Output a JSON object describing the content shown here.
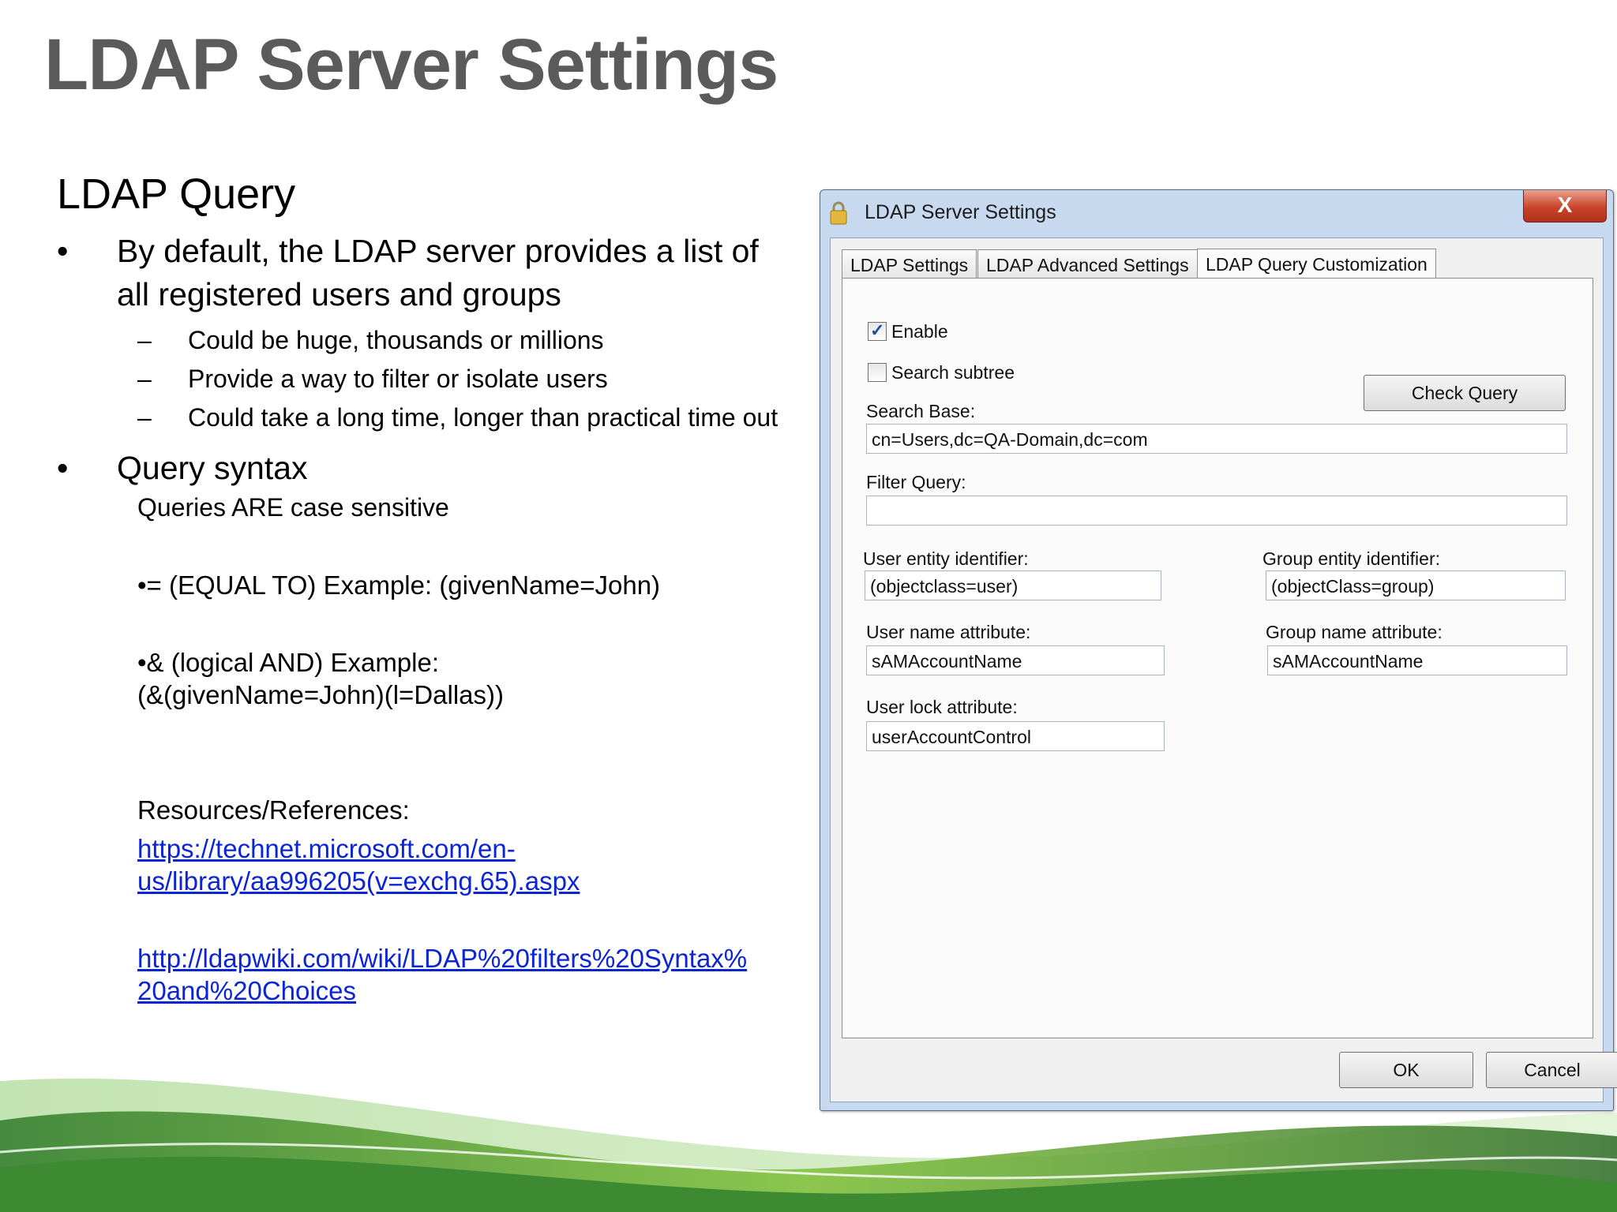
{
  "slide": {
    "title": "LDAP Server Settings",
    "subhead": "LDAP Query",
    "bullet1": "By default, the LDAP server provides a list of all registered users and groups",
    "sub1": "Could be huge, thousands or millions",
    "sub2": "Provide a way to filter or isolate users",
    "sub3": "Could take a long time, longer than practical time out",
    "bullet2": "Query syntax",
    "case_note": "Queries ARE case sensitive",
    "equal_example": "•= (EQUAL TO) Example: (givenName=John)",
    "and_example_1": "•& (logical AND) Example:",
    "and_example_2": "(&(givenName=John)(l=Dallas))",
    "resources_label": "Resources/References:",
    "link1_line1": "https://technet.microsoft.com/en-",
    "link1_line2": "us/library/aa996205(v=exchg.65).aspx",
    "link2_line1": "http://ldapwiki.com/wiki/LDAP%20filters%20Syntax%",
    "link2_line2": "20and%20Choices",
    "bullet_glyph": "•",
    "dash_glyph": "–"
  },
  "dialog": {
    "title": "LDAP Server Settings",
    "close_label": "X",
    "tabs": [
      {
        "label": "LDAP Settings",
        "active": false
      },
      {
        "label": "LDAP Advanced Settings",
        "active": false
      },
      {
        "label": "LDAP Query Customization",
        "active": true
      }
    ],
    "enable": {
      "label": "Enable",
      "checked": true
    },
    "search_subtree": {
      "label": "Search subtree",
      "checked": false
    },
    "check_query_label": "Check Query",
    "search_base": {
      "label": "Search Base:",
      "value": "cn=Users,dc=QA-Domain,dc=com"
    },
    "filter_query": {
      "label": "Filter Query:",
      "value": ""
    },
    "user_entity": {
      "label": "User entity identifier:",
      "value": "(objectclass=user)"
    },
    "group_entity": {
      "label": "Group entity identifier:",
      "value": "(objectClass=group)"
    },
    "user_name_attr": {
      "label": "User name attribute:",
      "value": "sAMAccountName"
    },
    "group_name_attr": {
      "label": "Group name attribute:",
      "value": "sAMAccountName"
    },
    "user_lock_attr": {
      "label": "User lock attribute:",
      "value": "userAccountControl"
    },
    "ok_label": "OK",
    "cancel_label": "Cancel"
  }
}
